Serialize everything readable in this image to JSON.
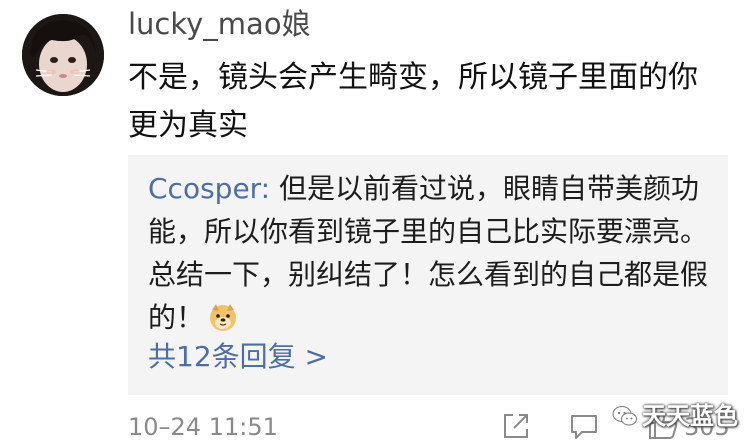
{
  "comment": {
    "username": "lucky_mao娘",
    "text": "不是，镜头会产生畸变，所以镜子里面的你更为真实",
    "timestamp": "10–24 11:51",
    "like_count": "305"
  },
  "reply": {
    "author": "Ccosper:",
    "text": " 但是以前看过说，眼睛自带美颜功能，所以你看到镜子里的自己比实际要漂亮。总结一下，别纠结了！怎么看到的自己都是假的！",
    "emoji": "doge-emoji",
    "more_label": "共12条回复 >"
  },
  "icons": {
    "share": "share-icon",
    "comment": "comment-icon",
    "like": "thumbs-up-icon"
  },
  "watermark": {
    "text": "天天蓝色"
  },
  "colors": {
    "link_blue": "#4e6ea3",
    "reply_bg": "#f4f4f4",
    "meta_gray": "#8a8a8a"
  }
}
